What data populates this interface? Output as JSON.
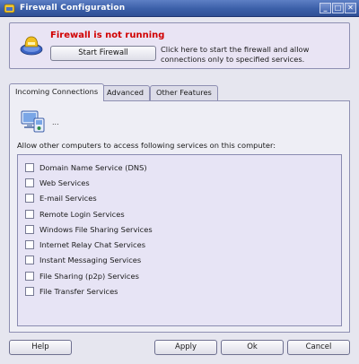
{
  "window": {
    "title": "Firewall Configuration",
    "minimize": "_",
    "maximize": "□",
    "close": "✕"
  },
  "banner": {
    "status": "Firewall is not running",
    "start_button": "Start Firewall",
    "description": "Click here to start the firewall and allow connections only to specified services.",
    "status_color": "#d10000"
  },
  "tabs": [
    {
      "label": "Incoming Connections",
      "active": true
    },
    {
      "label": "Advanced",
      "active": false
    },
    {
      "label": "Other Features",
      "active": false
    }
  ],
  "panel": {
    "ellipsis": "...",
    "allow_label": "Allow other computers to access following services on this computer:",
    "services": [
      {
        "label": "Domain Name Service (DNS)",
        "checked": false
      },
      {
        "label": "Web Services",
        "checked": false
      },
      {
        "label": "E-mail Services",
        "checked": false
      },
      {
        "label": "Remote Login Services",
        "checked": false
      },
      {
        "label": "Windows File Sharing Services",
        "checked": false
      },
      {
        "label": "Internet Relay Chat Services",
        "checked": false
      },
      {
        "label": "Instant Messaging Services",
        "checked": false
      },
      {
        "label": "File Sharing (p2p) Services",
        "checked": false
      },
      {
        "label": "File Transfer Services",
        "checked": false
      }
    ]
  },
  "buttons": {
    "help": "Help",
    "apply": "Apply",
    "ok": "Ok",
    "cancel": "Cancel"
  }
}
